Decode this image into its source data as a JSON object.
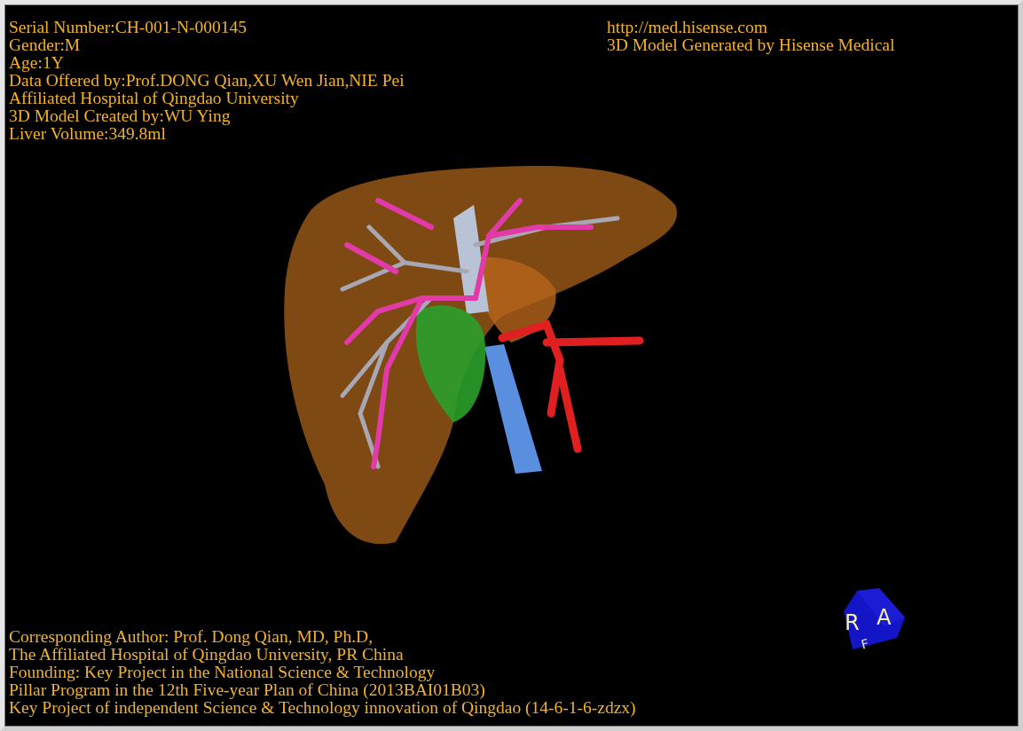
{
  "viewer": {
    "top_left_info": [
      "Serial Number:CH-001-N-000145",
      "Gender:M",
      "Age:1Y",
      "Data Offered by:Prof.DONG Qian,XU Wen Jian,NIE Pei",
      "Affiliated Hospital of Qingdao University",
      "3D Model Created by:WU Ying",
      "Liver Volume:349.8ml"
    ],
    "top_right_info": [
      "http://med.hisense.com",
      "3D Model Generated by Hisense Medical"
    ],
    "bottom_info": [
      "Corresponding Author: Prof. Dong Qian, MD, Ph.D,",
      "The Affiliated Hospital of Qingdao University, PR China",
      "Founding: Key Project in the National Science & Technology",
      "Pillar Program in the 12th Five-year Plan of China (2013BAI01B03)",
      "Key Project of independent Science & Technology innovation of Qingdao (14-6-1-6-zdzx)"
    ],
    "orientation_cube": {
      "labels": [
        "R",
        "A",
        "F"
      ]
    }
  }
}
